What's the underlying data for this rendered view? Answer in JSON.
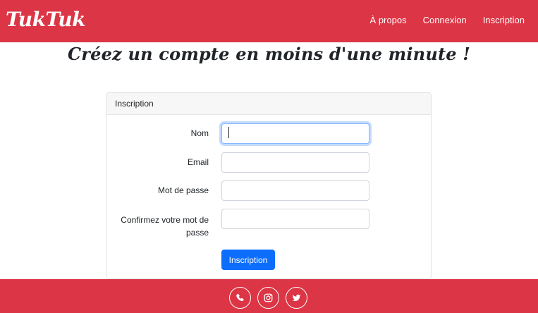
{
  "navbar": {
    "brand": "TukTuk",
    "links": [
      {
        "label": "À propos"
      },
      {
        "label": "Connexion"
      },
      {
        "label": "Inscription"
      }
    ]
  },
  "headline": "Créez un compte en moins d'une minute !",
  "form": {
    "header": "Inscription",
    "fields": [
      {
        "label": "Nom",
        "value": ""
      },
      {
        "label": "Email",
        "value": ""
      },
      {
        "label": "Mot de passe",
        "value": ""
      },
      {
        "label_line1": "Confirmez votre mot de",
        "label_line2": "passe",
        "value": ""
      }
    ],
    "submit_label": "Inscription"
  },
  "footer": {
    "social": [
      {
        "icon": "phone-icon"
      },
      {
        "icon": "instagram-icon"
      },
      {
        "icon": "twitter-icon"
      }
    ]
  },
  "colors": {
    "primary_red": "#dc3545",
    "button_blue": "#0d6efd"
  }
}
